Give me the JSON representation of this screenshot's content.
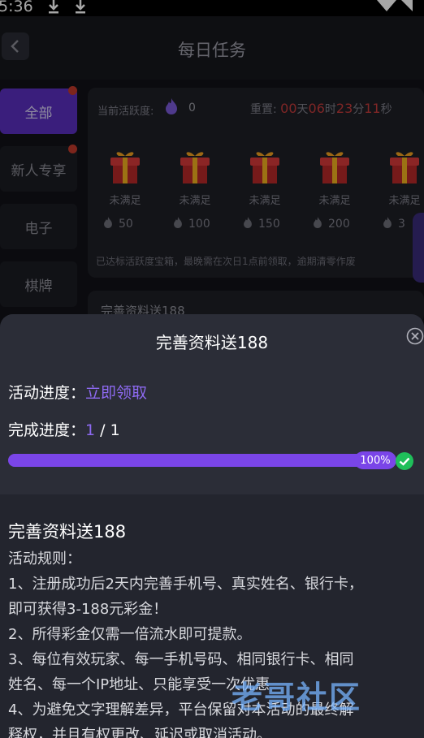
{
  "status_bar": {
    "time": "5:36"
  },
  "header": {
    "title": "每日任务"
  },
  "sidebar": {
    "items": [
      {
        "label": "全部",
        "active": true,
        "badge": true
      },
      {
        "label": "新人专享",
        "active": false,
        "badge": true
      },
      {
        "label": "电子",
        "active": false,
        "badge": false
      },
      {
        "label": "棋牌",
        "active": false,
        "badge": false
      }
    ]
  },
  "activity": {
    "label": "当前活跃度:",
    "value": "0",
    "reset_label": "重置:",
    "days": "00",
    "days_unit": "天",
    "hours": "06",
    "hours_unit": "时",
    "minutes": "23",
    "minutes_unit": "分",
    "seconds": "11",
    "seconds_unit": "秒"
  },
  "gifts": [
    {
      "status": "未满足",
      "points": "50"
    },
    {
      "status": "未满足",
      "points": "100"
    },
    {
      "status": "未满足",
      "points": "150"
    },
    {
      "status": "未满足",
      "points": "200"
    },
    {
      "status": "未满足",
      "points": "3"
    }
  ],
  "note": "已达标活跃度宝箱，最晚需在次日1点前领取，逾期清零作废",
  "second_card": {
    "title": "完善资料送188"
  },
  "sheet": {
    "title": "完善资料送188",
    "activity_progress_label": "活动进度：",
    "activity_progress_action": "立即领取",
    "completion_label": "完成进度：",
    "completion_current": "1",
    "completion_total": "/ 1",
    "progress_percent_label": "100%",
    "progress_fraction": 1.0,
    "rules_title": "完善资料送188",
    "rules": [
      "活动规则：",
      "1、注册成功后2天内完善手机号、真实姓名、银行卡，",
      "即可获得3-188元彩金！",
      "2、所得彩金仅需一倍流水即可提款。",
      "3、每位有效玩家、每一手机号码、相同银行卡、相同",
      "姓名、每一个IP地址、只能享受一次优惠",
      "4、为避免文字理解差异，平台保留对本活动的最终解",
      "释权，并且有权更改、延迟或取消活动。"
    ]
  },
  "watermark": "老哥社区",
  "colors": {
    "accent": "#7a45e8",
    "countdown": "#c43b3b",
    "success": "#1fbf5a"
  }
}
